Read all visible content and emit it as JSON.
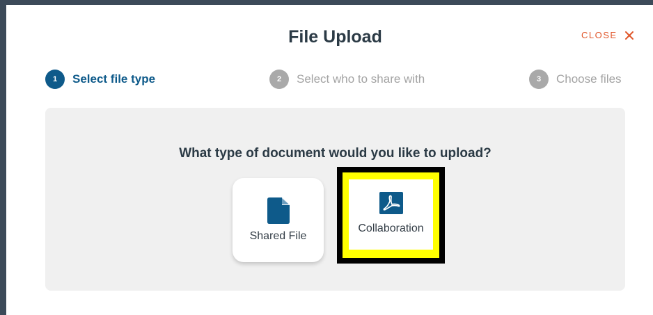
{
  "modal": {
    "title": "File Upload",
    "close_label": "CLOSE",
    "close_icon": "close-x-icon"
  },
  "steps": [
    {
      "number": "1",
      "label": "Select file type",
      "active": true
    },
    {
      "number": "2",
      "label": "Select who to share with",
      "active": false
    },
    {
      "number": "3",
      "label": "Choose files",
      "active": false
    }
  ],
  "panel": {
    "question": "What type of document would you like to upload?",
    "options": [
      {
        "label": "Shared File",
        "icon": "document-icon"
      },
      {
        "label": "Collaboration",
        "icon": "pdf-icon",
        "highlighted": true
      }
    ]
  },
  "colors": {
    "accent": "#0e5a8a",
    "close": "#e0562a",
    "inactive_step": "#a9a9a9",
    "highlight": "#ffff00"
  }
}
